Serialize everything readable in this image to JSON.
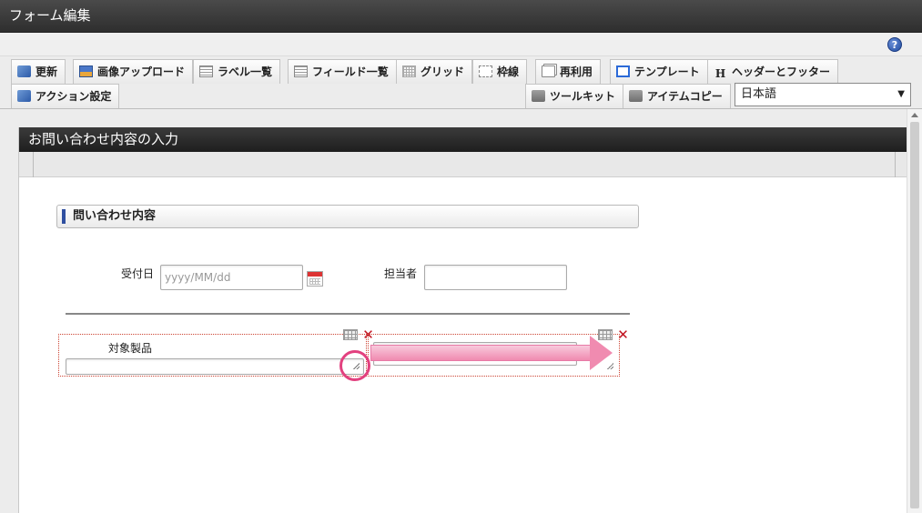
{
  "window": {
    "title": "フォーム編集"
  },
  "help": {
    "icon": "help-icon"
  },
  "toolbar": {
    "row1": [
      {
        "label": "更新",
        "icon": "update-icon"
      },
      {
        "label": "画像アップロード",
        "icon": "image-upload-icon"
      },
      {
        "label": "ラベル一覧",
        "icon": "label-list-icon"
      },
      {
        "label": "フィールド一覧",
        "icon": "field-list-icon"
      },
      {
        "label": "グリッド",
        "icon": "grid-icon"
      },
      {
        "label": "枠線",
        "icon": "border-icon"
      },
      {
        "label": "再利用",
        "icon": "reuse-icon"
      },
      {
        "label": "テンプレート",
        "icon": "template-icon"
      },
      {
        "label": "ヘッダーとフッター",
        "icon": "header-footer-icon"
      }
    ],
    "row2": [
      {
        "label": "アクション設定",
        "icon": "action-icon"
      },
      {
        "label": "ツールキット",
        "icon": "toolkit-icon"
      },
      {
        "label": "アイテムコピー",
        "icon": "item-copy-icon"
      }
    ],
    "language": {
      "selected": "日本語"
    }
  },
  "form": {
    "header_title": "お問い合わせ内容の入力",
    "section_title": "問い合わせ内容",
    "fields": {
      "received_date": {
        "label": "受付日",
        "placeholder": "yyyy/MM/dd"
      },
      "assignee": {
        "label": "担当者",
        "value": ""
      },
      "product": {
        "label": "対象製品",
        "value": ""
      }
    }
  },
  "annotation": {
    "arrow_color": "#f08bb0",
    "circle_color": "#e2417f"
  }
}
